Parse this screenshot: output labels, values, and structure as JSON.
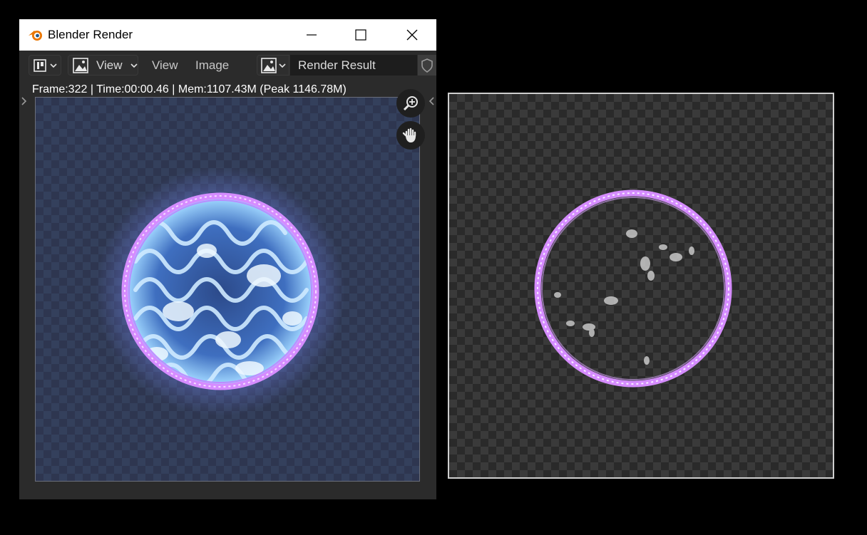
{
  "window": {
    "title": "Blender Render",
    "controls": [
      "minimize",
      "maximize",
      "close"
    ]
  },
  "header": {
    "editor_type_icon": "image-editor-icon",
    "view_mode_label": "View",
    "menus": [
      "View",
      "Image"
    ],
    "image_name": "Render Result",
    "fake_user_icon": "shield-icon"
  },
  "render": {
    "stats": "Frame:322 | Time:00:00.46 | Mem:1107.43M (Peak 1146.78M)"
  },
  "navigation": {
    "zoom_icon": "zoom-icon",
    "pan_icon": "hand-icon"
  },
  "colors": {
    "ring": "#d58cff",
    "core": "#9fd6ff",
    "glow": "#7a8cff",
    "blender_orange": "#ea7600",
    "blender_blue": "#265787"
  }
}
